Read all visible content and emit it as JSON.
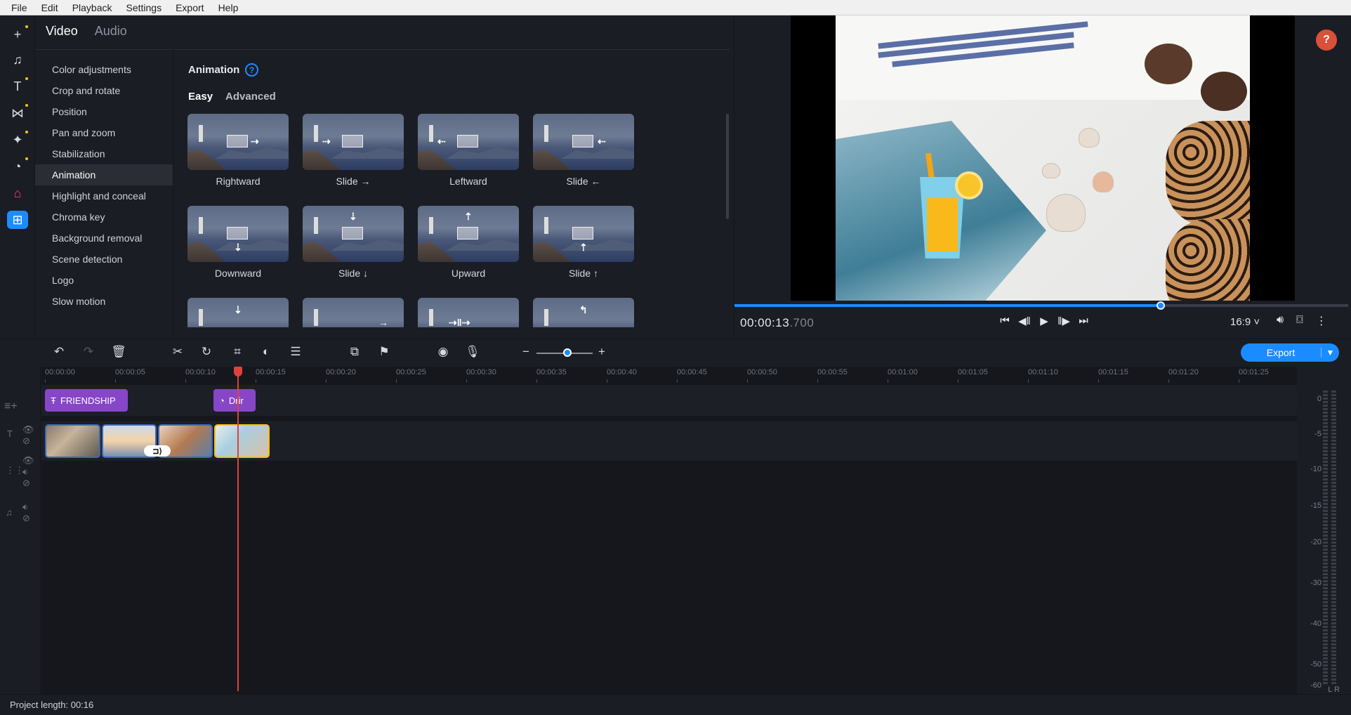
{
  "menu": [
    "File",
    "Edit",
    "Playback",
    "Settings",
    "Export",
    "Help"
  ],
  "media_tabs": {
    "video": "Video",
    "audio": "Audio"
  },
  "sidebar": {
    "items": [
      {
        "label": "Color adjustments"
      },
      {
        "label": "Crop and rotate"
      },
      {
        "label": "Position"
      },
      {
        "label": "Pan and zoom"
      },
      {
        "label": "Stabilization"
      },
      {
        "label": "Animation",
        "selected": true
      },
      {
        "label": "Highlight and conceal"
      },
      {
        "label": "Chroma key"
      },
      {
        "label": "Background removal"
      },
      {
        "label": "Scene detection"
      },
      {
        "label": "Logo"
      },
      {
        "label": "Slow motion"
      }
    ]
  },
  "panel": {
    "title": "Animation",
    "help_icon": "question-icon",
    "tabs": {
      "easy": "Easy",
      "advanced": "Advanced"
    },
    "presets": [
      {
        "label": "Rightward",
        "arrow": "→"
      },
      {
        "label": "Slide →",
        "arrow": "→"
      },
      {
        "label": "Leftward",
        "arrow": "←"
      },
      {
        "label": "Slide ←",
        "arrow": "←"
      },
      {
        "label": "Downward",
        "arrow": "↓"
      },
      {
        "label": "Slide ↓",
        "arrow": "↓"
      },
      {
        "label": "Upward",
        "arrow": "↑"
      },
      {
        "label": "Slide ↑",
        "arrow": "↑"
      }
    ]
  },
  "preview": {
    "timecode_main": "00:00:13",
    "timecode_ms": ".700",
    "aspect_ratio": "16:9 ˅",
    "progress_fraction": 0.695,
    "help_button": "?"
  },
  "toolbar": {
    "export_label": "Export",
    "zoom_fraction": 0.55
  },
  "timeline": {
    "ticks": [
      "00:00:00",
      "00:00:05",
      "00:00:10",
      "00:00:15",
      "00:00:20",
      "00:00:25",
      "00:00:30",
      "00:00:35",
      "00:00:40",
      "00:00:45",
      "00:00:50",
      "00:00:55",
      "00:01:00",
      "00:01:05",
      "00:01:10",
      "00:01:15",
      "00:01:20",
      "00:01:25"
    ],
    "title_clips": [
      {
        "label": "FRIENDSHIP"
      },
      {
        "label": "Drir"
      }
    ]
  },
  "meter": {
    "labels": [
      "0",
      "-5",
      "-10",
      "-15",
      "-20",
      "-30",
      "-40",
      "-50",
      "-60"
    ],
    "channels": "L R"
  },
  "status": {
    "project_length": "Project length: 00:16"
  },
  "colors": {
    "accent": "#1b8cff",
    "title_clip": "#8746c8",
    "playhead": "#e0413b",
    "selected_clip": "#f2c211"
  }
}
